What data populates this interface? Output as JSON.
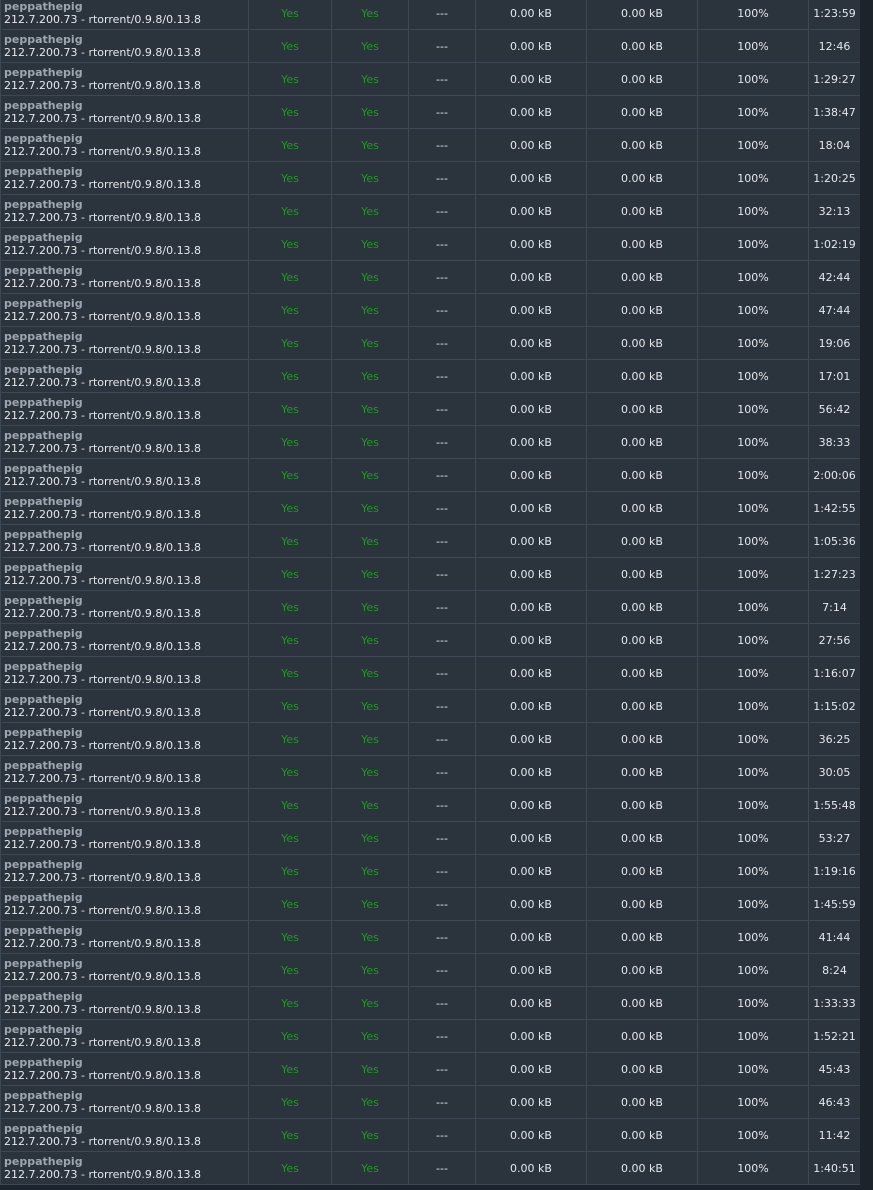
{
  "peers": {
    "rows": [
      {
        "user": "peppathepig",
        "client": "212.7.200.73 - rtorrent/0.9.8/0.13.8",
        "interested": "Yes",
        "choked": "Yes",
        "flags": "---",
        "down": "0.00 kB",
        "up": "0.00 kB",
        "done": "100%",
        "time": "1:23:59"
      },
      {
        "user": "peppathepig",
        "client": "212.7.200.73 - rtorrent/0.9.8/0.13.8",
        "interested": "Yes",
        "choked": "Yes",
        "flags": "---",
        "down": "0.00 kB",
        "up": "0.00 kB",
        "done": "100%",
        "time": "12:46"
      },
      {
        "user": "peppathepig",
        "client": "212.7.200.73 - rtorrent/0.9.8/0.13.8",
        "interested": "Yes",
        "choked": "Yes",
        "flags": "---",
        "down": "0.00 kB",
        "up": "0.00 kB",
        "done": "100%",
        "time": "1:29:27"
      },
      {
        "user": "peppathepig",
        "client": "212.7.200.73 - rtorrent/0.9.8/0.13.8",
        "interested": "Yes",
        "choked": "Yes",
        "flags": "---",
        "down": "0.00 kB",
        "up": "0.00 kB",
        "done": "100%",
        "time": "1:38:47"
      },
      {
        "user": "peppathepig",
        "client": "212.7.200.73 - rtorrent/0.9.8/0.13.8",
        "interested": "Yes",
        "choked": "Yes",
        "flags": "---",
        "down": "0.00 kB",
        "up": "0.00 kB",
        "done": "100%",
        "time": "18:04"
      },
      {
        "user": "peppathepig",
        "client": "212.7.200.73 - rtorrent/0.9.8/0.13.8",
        "interested": "Yes",
        "choked": "Yes",
        "flags": "---",
        "down": "0.00 kB",
        "up": "0.00 kB",
        "done": "100%",
        "time": "1:20:25"
      },
      {
        "user": "peppathepig",
        "client": "212.7.200.73 - rtorrent/0.9.8/0.13.8",
        "interested": "Yes",
        "choked": "Yes",
        "flags": "---",
        "down": "0.00 kB",
        "up": "0.00 kB",
        "done": "100%",
        "time": "32:13"
      },
      {
        "user": "peppathepig",
        "client": "212.7.200.73 - rtorrent/0.9.8/0.13.8",
        "interested": "Yes",
        "choked": "Yes",
        "flags": "---",
        "down": "0.00 kB",
        "up": "0.00 kB",
        "done": "100%",
        "time": "1:02:19"
      },
      {
        "user": "peppathepig",
        "client": "212.7.200.73 - rtorrent/0.9.8/0.13.8",
        "interested": "Yes",
        "choked": "Yes",
        "flags": "---",
        "down": "0.00 kB",
        "up": "0.00 kB",
        "done": "100%",
        "time": "42:44"
      },
      {
        "user": "peppathepig",
        "client": "212.7.200.73 - rtorrent/0.9.8/0.13.8",
        "interested": "Yes",
        "choked": "Yes",
        "flags": "---",
        "down": "0.00 kB",
        "up": "0.00 kB",
        "done": "100%",
        "time": "47:44"
      },
      {
        "user": "peppathepig",
        "client": "212.7.200.73 - rtorrent/0.9.8/0.13.8",
        "interested": "Yes",
        "choked": "Yes",
        "flags": "---",
        "down": "0.00 kB",
        "up": "0.00 kB",
        "done": "100%",
        "time": "19:06"
      },
      {
        "user": "peppathepig",
        "client": "212.7.200.73 - rtorrent/0.9.8/0.13.8",
        "interested": "Yes",
        "choked": "Yes",
        "flags": "---",
        "down": "0.00 kB",
        "up": "0.00 kB",
        "done": "100%",
        "time": "17:01"
      },
      {
        "user": "peppathepig",
        "client": "212.7.200.73 - rtorrent/0.9.8/0.13.8",
        "interested": "Yes",
        "choked": "Yes",
        "flags": "---",
        "down": "0.00 kB",
        "up": "0.00 kB",
        "done": "100%",
        "time": "56:42"
      },
      {
        "user": "peppathepig",
        "client": "212.7.200.73 - rtorrent/0.9.8/0.13.8",
        "interested": "Yes",
        "choked": "Yes",
        "flags": "---",
        "down": "0.00 kB",
        "up": "0.00 kB",
        "done": "100%",
        "time": "38:33"
      },
      {
        "user": "peppathepig",
        "client": "212.7.200.73 - rtorrent/0.9.8/0.13.8",
        "interested": "Yes",
        "choked": "Yes",
        "flags": "---",
        "down": "0.00 kB",
        "up": "0.00 kB",
        "done": "100%",
        "time": "2:00:06"
      },
      {
        "user": "peppathepig",
        "client": "212.7.200.73 - rtorrent/0.9.8/0.13.8",
        "interested": "Yes",
        "choked": "Yes",
        "flags": "---",
        "down": "0.00 kB",
        "up": "0.00 kB",
        "done": "100%",
        "time": "1:42:55"
      },
      {
        "user": "peppathepig",
        "client": "212.7.200.73 - rtorrent/0.9.8/0.13.8",
        "interested": "Yes",
        "choked": "Yes",
        "flags": "---",
        "down": "0.00 kB",
        "up": "0.00 kB",
        "done": "100%",
        "time": "1:05:36"
      },
      {
        "user": "peppathepig",
        "client": "212.7.200.73 - rtorrent/0.9.8/0.13.8",
        "interested": "Yes",
        "choked": "Yes",
        "flags": "---",
        "down": "0.00 kB",
        "up": "0.00 kB",
        "done": "100%",
        "time": "1:27:23"
      },
      {
        "user": "peppathepig",
        "client": "212.7.200.73 - rtorrent/0.9.8/0.13.8",
        "interested": "Yes",
        "choked": "Yes",
        "flags": "---",
        "down": "0.00 kB",
        "up": "0.00 kB",
        "done": "100%",
        "time": "7:14"
      },
      {
        "user": "peppathepig",
        "client": "212.7.200.73 - rtorrent/0.9.8/0.13.8",
        "interested": "Yes",
        "choked": "Yes",
        "flags": "---",
        "down": "0.00 kB",
        "up": "0.00 kB",
        "done": "100%",
        "time": "27:56"
      },
      {
        "user": "peppathepig",
        "client": "212.7.200.73 - rtorrent/0.9.8/0.13.8",
        "interested": "Yes",
        "choked": "Yes",
        "flags": "---",
        "down": "0.00 kB",
        "up": "0.00 kB",
        "done": "100%",
        "time": "1:16:07"
      },
      {
        "user": "peppathepig",
        "client": "212.7.200.73 - rtorrent/0.9.8/0.13.8",
        "interested": "Yes",
        "choked": "Yes",
        "flags": "---",
        "down": "0.00 kB",
        "up": "0.00 kB",
        "done": "100%",
        "time": "1:15:02"
      },
      {
        "user": "peppathepig",
        "client": "212.7.200.73 - rtorrent/0.9.8/0.13.8",
        "interested": "Yes",
        "choked": "Yes",
        "flags": "---",
        "down": "0.00 kB",
        "up": "0.00 kB",
        "done": "100%",
        "time": "36:25"
      },
      {
        "user": "peppathepig",
        "client": "212.7.200.73 - rtorrent/0.9.8/0.13.8",
        "interested": "Yes",
        "choked": "Yes",
        "flags": "---",
        "down": "0.00 kB",
        "up": "0.00 kB",
        "done": "100%",
        "time": "30:05"
      },
      {
        "user": "peppathepig",
        "client": "212.7.200.73 - rtorrent/0.9.8/0.13.8",
        "interested": "Yes",
        "choked": "Yes",
        "flags": "---",
        "down": "0.00 kB",
        "up": "0.00 kB",
        "done": "100%",
        "time": "1:55:48"
      },
      {
        "user": "peppathepig",
        "client": "212.7.200.73 - rtorrent/0.9.8/0.13.8",
        "interested": "Yes",
        "choked": "Yes",
        "flags": "---",
        "down": "0.00 kB",
        "up": "0.00 kB",
        "done": "100%",
        "time": "53:27"
      },
      {
        "user": "peppathepig",
        "client": "212.7.200.73 - rtorrent/0.9.8/0.13.8",
        "interested": "Yes",
        "choked": "Yes",
        "flags": "---",
        "down": "0.00 kB",
        "up": "0.00 kB",
        "done": "100%",
        "time": "1:19:16"
      },
      {
        "user": "peppathepig",
        "client": "212.7.200.73 - rtorrent/0.9.8/0.13.8",
        "interested": "Yes",
        "choked": "Yes",
        "flags": "---",
        "down": "0.00 kB",
        "up": "0.00 kB",
        "done": "100%",
        "time": "1:45:59"
      },
      {
        "user": "peppathepig",
        "client": "212.7.200.73 - rtorrent/0.9.8/0.13.8",
        "interested": "Yes",
        "choked": "Yes",
        "flags": "---",
        "down": "0.00 kB",
        "up": "0.00 kB",
        "done": "100%",
        "time": "41:44"
      },
      {
        "user": "peppathepig",
        "client": "212.7.200.73 - rtorrent/0.9.8/0.13.8",
        "interested": "Yes",
        "choked": "Yes",
        "flags": "---",
        "down": "0.00 kB",
        "up": "0.00 kB",
        "done": "100%",
        "time": "8:24"
      },
      {
        "user": "peppathepig",
        "client": "212.7.200.73 - rtorrent/0.9.8/0.13.8",
        "interested": "Yes",
        "choked": "Yes",
        "flags": "---",
        "down": "0.00 kB",
        "up": "0.00 kB",
        "done": "100%",
        "time": "1:33:33"
      },
      {
        "user": "peppathepig",
        "client": "212.7.200.73 - rtorrent/0.9.8/0.13.8",
        "interested": "Yes",
        "choked": "Yes",
        "flags": "---",
        "down": "0.00 kB",
        "up": "0.00 kB",
        "done": "100%",
        "time": "1:52:21"
      },
      {
        "user": "peppathepig",
        "client": "212.7.200.73 - rtorrent/0.9.8/0.13.8",
        "interested": "Yes",
        "choked": "Yes",
        "flags": "---",
        "down": "0.00 kB",
        "up": "0.00 kB",
        "done": "100%",
        "time": "45:43"
      },
      {
        "user": "peppathepig",
        "client": "212.7.200.73 - rtorrent/0.9.8/0.13.8",
        "interested": "Yes",
        "choked": "Yes",
        "flags": "---",
        "down": "0.00 kB",
        "up": "0.00 kB",
        "done": "100%",
        "time": "46:43"
      },
      {
        "user": "peppathepig",
        "client": "212.7.200.73 - rtorrent/0.9.8/0.13.8",
        "interested": "Yes",
        "choked": "Yes",
        "flags": "---",
        "down": "0.00 kB",
        "up": "0.00 kB",
        "done": "100%",
        "time": "11:42"
      },
      {
        "user": "peppathepig",
        "client": "212.7.200.73 - rtorrent/0.9.8/0.13.8",
        "interested": "Yes",
        "choked": "Yes",
        "flags": "---",
        "down": "0.00 kB",
        "up": "0.00 kB",
        "done": "100%",
        "time": "1:40:51"
      }
    ]
  },
  "colors": {
    "page_background": "#1c232b",
    "row_background": "#2b333d",
    "grid_line": "#3d4854",
    "text": "#e4e8ec",
    "username": "#9ea7b1",
    "yes_green": "#1f9a22"
  }
}
